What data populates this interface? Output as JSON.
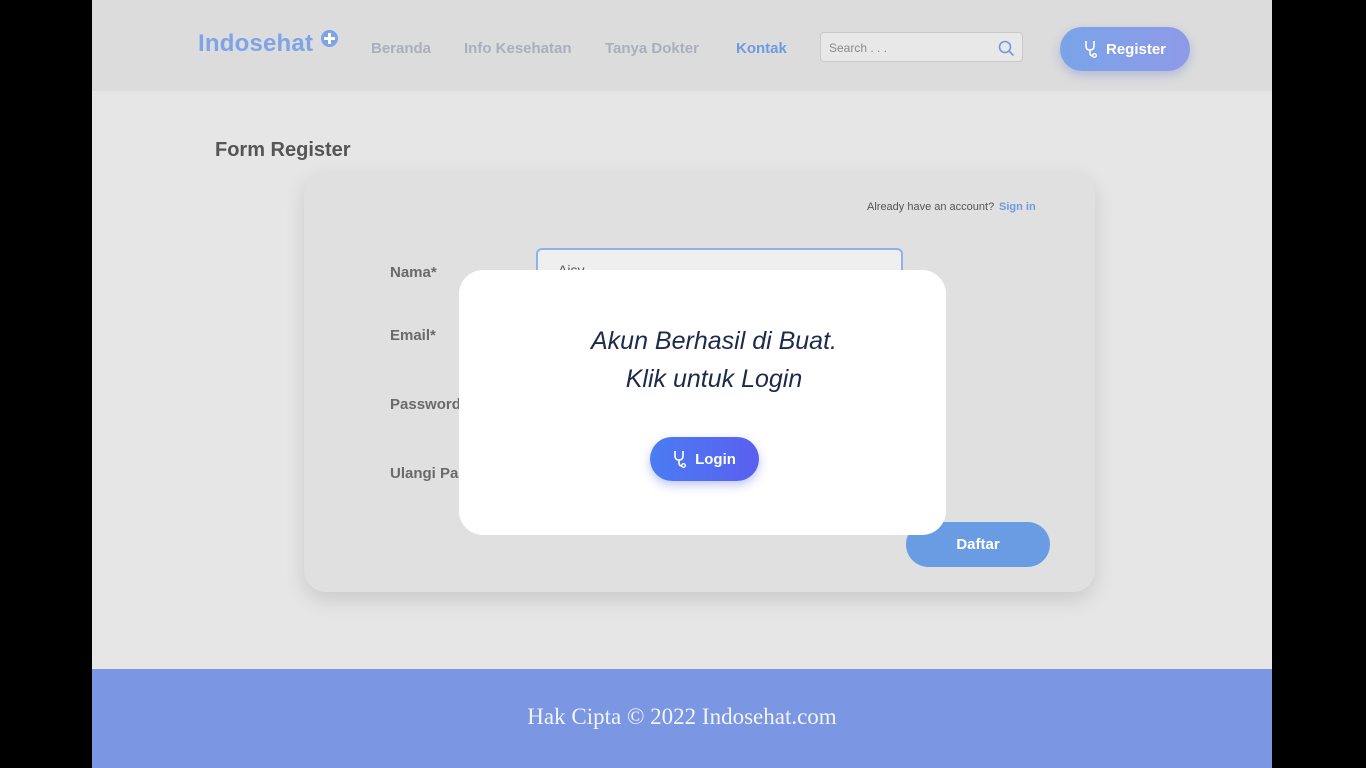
{
  "header": {
    "logo": "Indosehat",
    "nav": [
      {
        "label": "Beranda",
        "active": false
      },
      {
        "label": "Info Kesehatan",
        "active": false
      },
      {
        "label": "Tanya Dokter",
        "active": false
      },
      {
        "label": "Kontak",
        "active": true
      }
    ],
    "search": {
      "placeholder": "Search . . ."
    },
    "register_label": "Register"
  },
  "form": {
    "title": "Form Register",
    "already_text": "Already have an account?",
    "signin_label": "Sign in",
    "fields": {
      "nama": {
        "label": "Nama*",
        "value": "Aisy"
      },
      "email": {
        "label": "Email*"
      },
      "password": {
        "label": "Password*"
      },
      "ulangi": {
        "label": "Ulangi Password*"
      }
    },
    "submit_label": "Daftar"
  },
  "modal": {
    "line1": "Akun Berhasil di Buat.",
    "line2": "Klik untuk Login",
    "button_label": "Login"
  },
  "footer": {
    "text": "Hak Cipta © 2022 Indosehat.com"
  },
  "colors": {
    "brand": "#7ea3e6",
    "nav_active": "#6f9ae0",
    "footer": "#7b97e3",
    "login_button": "#4a7cf2"
  }
}
